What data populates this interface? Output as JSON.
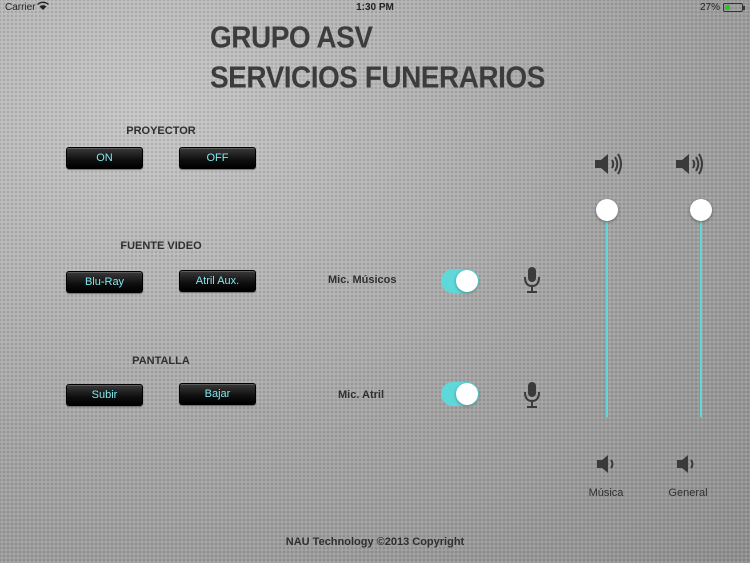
{
  "status_bar": {
    "carrier": "Carrier",
    "time": "1:30 PM",
    "battery": "27%"
  },
  "title": {
    "line1": "GRUPO ASV",
    "line2": "SERVICIOS FUNERARIOS"
  },
  "proyector": {
    "label": "PROYECTOR",
    "on": "ON",
    "off": "OFF"
  },
  "fuente_video": {
    "label": "FUENTE VIDEO",
    "bluray": "Blu-Ray",
    "atril_aux": "Atril Aux."
  },
  "pantalla": {
    "label": "PANTALLA",
    "subir": "Subir",
    "bajar": "Bajar"
  },
  "mics": [
    {
      "label": "Mic. Músicos",
      "on": true
    },
    {
      "label": "Mic. Atril",
      "on": true
    }
  ],
  "volume": {
    "musica": {
      "label": "Música",
      "level": 1.0
    },
    "general": {
      "label": "General",
      "level": 1.0
    }
  },
  "footer": "NAU Technology ©2013 Copyright",
  "colors": {
    "accent": "#5fd8da",
    "button_text": "#7fe8ef"
  },
  "icons": {
    "mic": "microphone-icon",
    "speaker_loud": "speaker-loud-icon",
    "speaker_low": "speaker-low-icon",
    "wifi": "wifi-icon",
    "battery": "battery-icon"
  }
}
